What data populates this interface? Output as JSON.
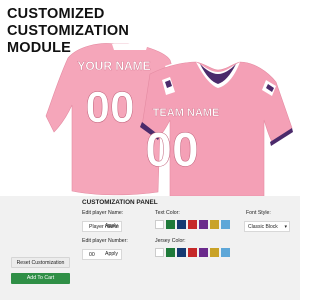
{
  "header": {
    "title_lines": [
      "CUSTOMIZED",
      "CUSTOMIZATION",
      "MODULE"
    ]
  },
  "jersey": {
    "back_name": "YOUR NAME",
    "back_number": "00",
    "front_name": "TEAM NAME",
    "front_number": "00",
    "base_color": "#f4a3b8",
    "stripe_color": "#4b2a6b",
    "text_color": "#ffffff"
  },
  "panel": {
    "title": "CUSTOMIZATION PANEL",
    "player_name": {
      "label": "Edit player Name:",
      "value": "Player Name",
      "apply_label": "Apply"
    },
    "player_number": {
      "label": "Edit player Number:",
      "value": "00",
      "apply_label": "Apply"
    },
    "text_color": {
      "label": "Text Color:",
      "swatches": [
        "#ffffff",
        "#1f7a3a",
        "#163a72",
        "#c62828",
        "#6b2a8c",
        "#c9a227",
        "#5ea7d8"
      ]
    },
    "jersey_color": {
      "label": "Jersey Color:",
      "swatches": [
        "#ffffff",
        "#1f7a3a",
        "#163a72",
        "#c62828",
        "#6b2a8c",
        "#c9a227",
        "#5ea7d8"
      ]
    },
    "font_style": {
      "label": "Font Style:",
      "value": "Classic Block"
    },
    "reset_label": "Reset Customization",
    "cart_label": "Add To Cart"
  }
}
